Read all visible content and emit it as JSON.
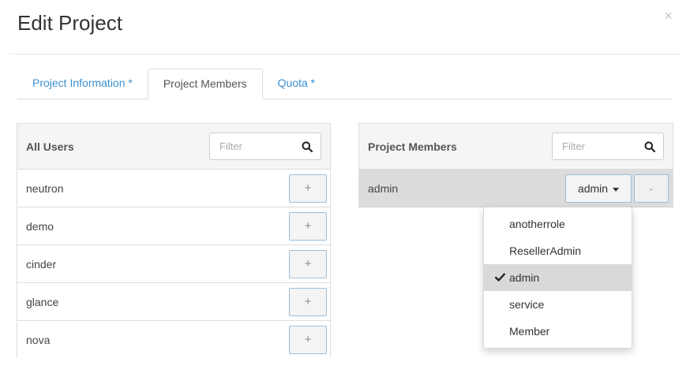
{
  "modal": {
    "title": "Edit Project",
    "close_label": "×"
  },
  "tabs": [
    {
      "label": "Project Information *",
      "active": false
    },
    {
      "label": "Project Members",
      "active": true
    },
    {
      "label": "Quota *",
      "active": false
    }
  ],
  "all_users": {
    "title": "All Users",
    "filter_placeholder": "Filter",
    "add_label": "+",
    "users": [
      "neutron",
      "demo",
      "cinder",
      "glance",
      "nova"
    ]
  },
  "project_members": {
    "title": "Project Members",
    "filter_placeholder": "Filter",
    "member": {
      "name": "admin",
      "role": "admin"
    },
    "remove_label": "-"
  },
  "role_menu": {
    "options": [
      "anotherrole",
      "ResellerAdmin",
      "admin",
      "service",
      "Member"
    ],
    "selected": "admin"
  },
  "colors": {
    "link": "#3a8fd0",
    "button_border": "#9bbfdb",
    "selected_bg": "#d9d9d9"
  }
}
